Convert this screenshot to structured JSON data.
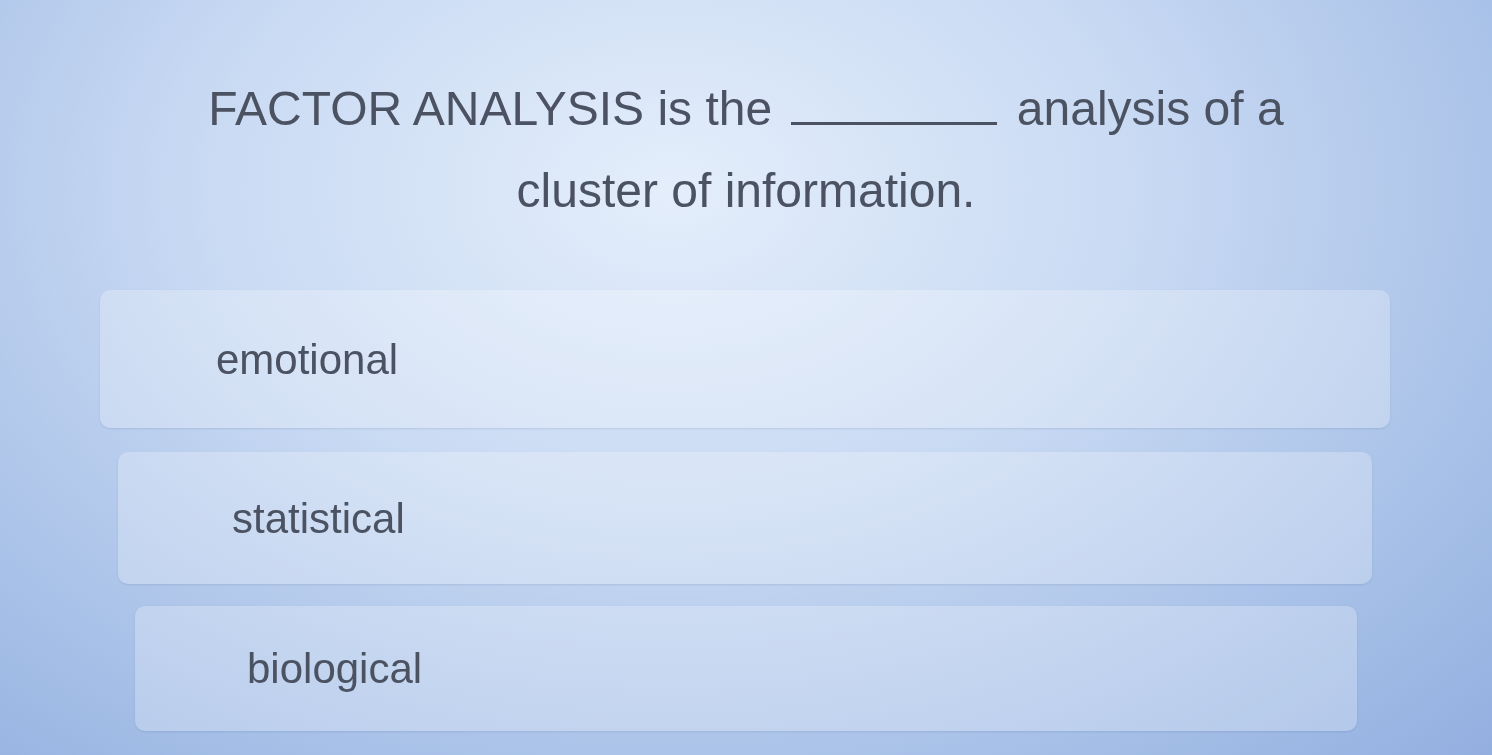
{
  "question": {
    "text_before_blank": "FACTOR ANALYSIS is the",
    "text_after_blank": "analysis of a cluster of information."
  },
  "options": [
    {
      "label": "emotional"
    },
    {
      "label": "statistical"
    },
    {
      "label": "biological"
    }
  ]
}
